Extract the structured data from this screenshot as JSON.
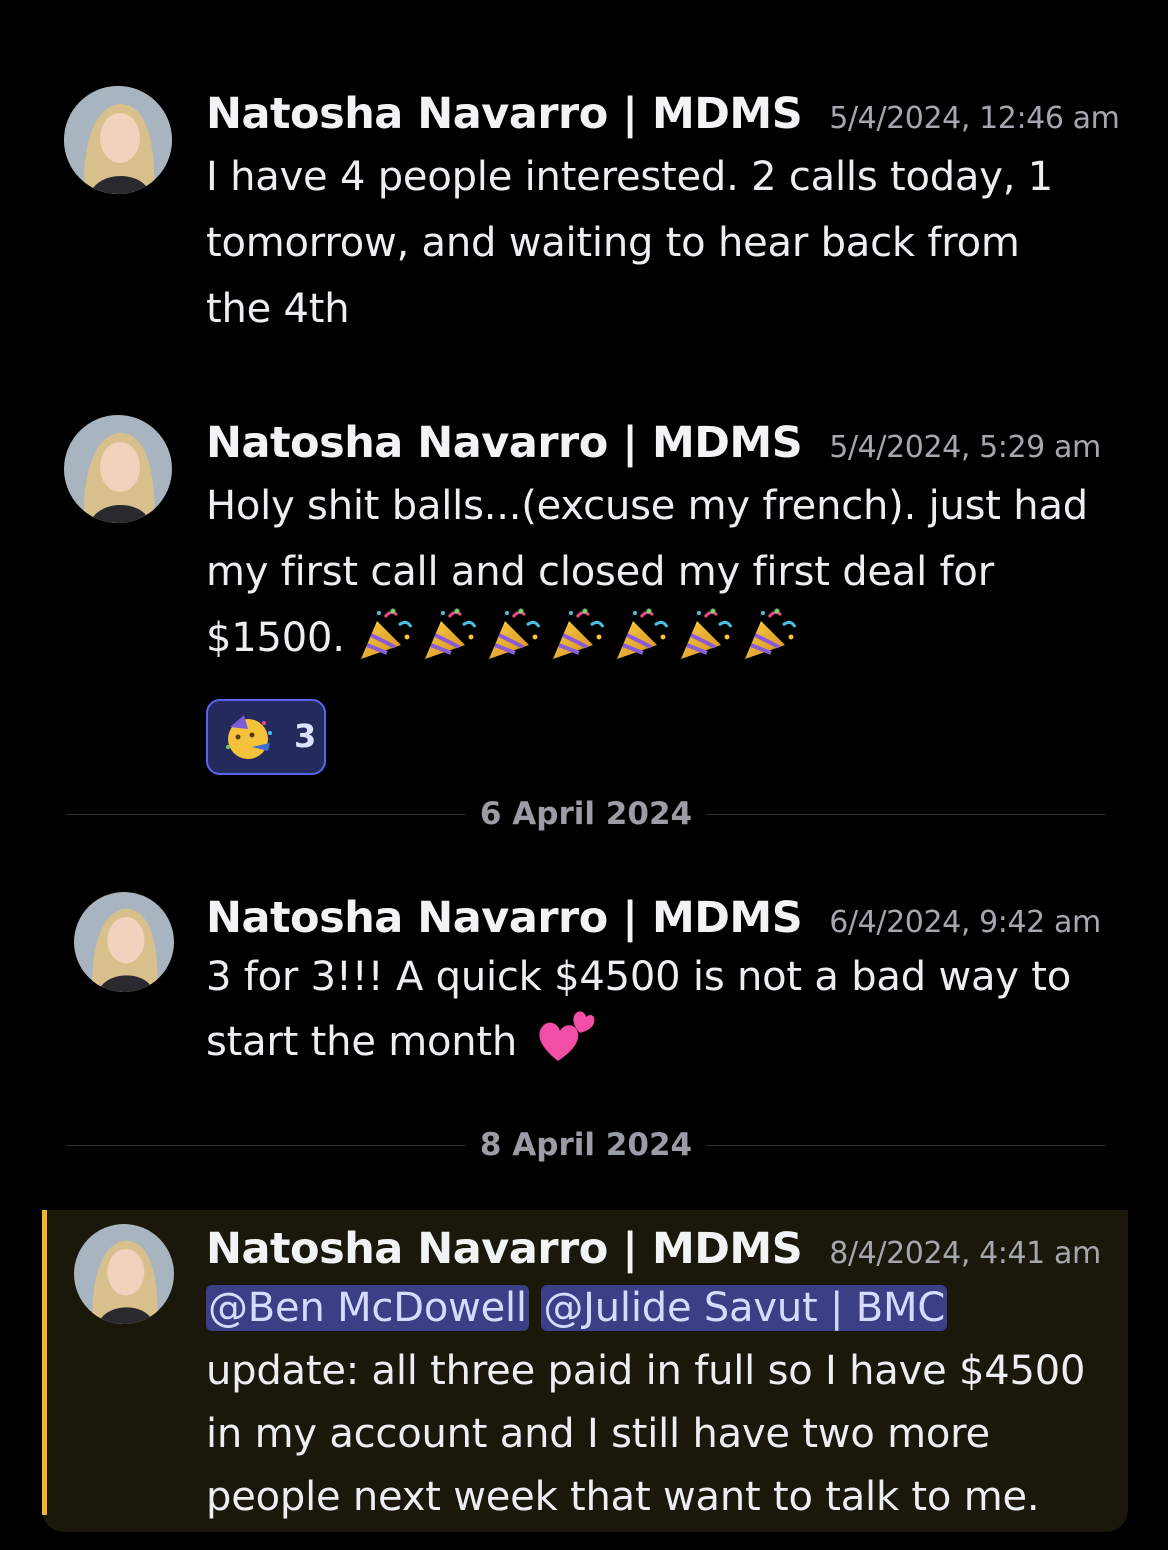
{
  "messages": [
    {
      "author": "Natosha Navarro | MDMS",
      "timestamp": "5/4/2024, 12:46 am",
      "lines": [
        "I have 4 people interested. 2 calls today, 1",
        "tomorrow, and waiting to hear back from",
        "the 4th"
      ]
    },
    {
      "author": "Natosha Navarro | MDMS",
      "timestamp": "5/4/2024, 5:29 am",
      "lines": [
        "Holy shit balls...(excuse my french). just had",
        "my first call and closed my first deal for",
        "$1500."
      ],
      "emoji": "party-popper-icon",
      "emoji_count_in_text": 7,
      "reaction": {
        "icon": "partying-face-icon",
        "count": "3"
      }
    },
    {
      "author": "Natosha Navarro | MDMS",
      "timestamp": "6/4/2024, 9:42 am",
      "lines": [
        "3 for 3!!! A quick $4500 is not a bad way to",
        "start the month"
      ],
      "emoji": "two-hearts-icon"
    },
    {
      "author": "Natosha Navarro | MDMS",
      "timestamp": "8/4/2024, 4:41 am",
      "mentions": [
        "@Ben McDowell",
        "@Julide Savut | BMC"
      ],
      "lines": [
        "update: all three paid in full so I have $4500",
        "in my account and I still have two more",
        "people next week that want to talk to me."
      ],
      "highlighted": true
    }
  ],
  "dividers": [
    "6 April 2024",
    "8 April 2024"
  ],
  "colors": {
    "background": "#000000",
    "mention_bg": "#3b3f86",
    "reaction_border": "#5865f2",
    "highlight_bar": "#f0b232"
  }
}
